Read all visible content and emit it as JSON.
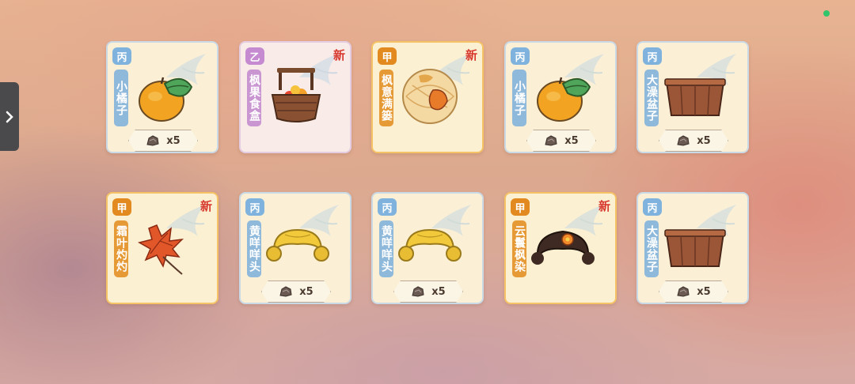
{
  "side_tab": {
    "icon": "chevron-right-icon"
  },
  "status_dot_color": "#32c46a",
  "cards": [
    {
      "grade": "丙",
      "name": "小橘子",
      "is_new": false,
      "new_label": "",
      "qty": "x5",
      "item_icon": "tangerine-icon",
      "rarity": "bing"
    },
    {
      "grade": "乙",
      "name": "枫果食盒",
      "is_new": true,
      "new_label": "新",
      "qty": "",
      "item_icon": "fruit-basket-icon",
      "rarity": "yi"
    },
    {
      "grade": "甲",
      "name": "枫意满篓",
      "is_new": true,
      "new_label": "新",
      "qty": "",
      "item_icon": "leaf-basket-icon",
      "rarity": "jia"
    },
    {
      "grade": "丙",
      "name": "小橘子",
      "is_new": false,
      "new_label": "",
      "qty": "x5",
      "item_icon": "tangerine-icon",
      "rarity": "bing"
    },
    {
      "grade": "丙",
      "name": "大澡盆子",
      "is_new": false,
      "new_label": "",
      "qty": "x5",
      "item_icon": "wooden-tub-icon",
      "rarity": "bing"
    },
    {
      "grade": "甲",
      "name": "霜叶灼灼",
      "is_new": true,
      "new_label": "新",
      "qty": "",
      "item_icon": "maple-leaf-icon",
      "rarity": "jia"
    },
    {
      "grade": "丙",
      "name": "黄咩咩头",
      "is_new": false,
      "new_label": "",
      "qty": "x5",
      "item_icon": "yellow-hair-icon",
      "rarity": "bing"
    },
    {
      "grade": "丙",
      "name": "黄咩咩头",
      "is_new": false,
      "new_label": "",
      "qty": "x5",
      "item_icon": "yellow-hair-icon",
      "rarity": "bing"
    },
    {
      "grade": "甲",
      "name": "云鬟枫染",
      "is_new": true,
      "new_label": "新",
      "qty": "",
      "item_icon": "dark-hair-icon",
      "rarity": "jia"
    },
    {
      "grade": "丙",
      "name": "大澡盆子",
      "is_new": false,
      "new_label": "",
      "qty": "x5",
      "item_icon": "wooden-tub-icon",
      "rarity": "bing"
    }
  ]
}
